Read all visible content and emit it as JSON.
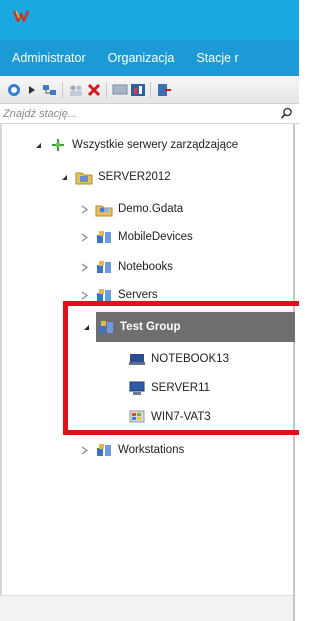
{
  "menu": {
    "items": [
      "Administrator",
      "Organizacja",
      "Stacje r"
    ]
  },
  "toolbar": {
    "icons": [
      "back-icon",
      "play-icon",
      "network-add-icon",
      "users-icon",
      "delete-x-icon",
      "monitor-icon",
      "report-icon",
      "export-icon"
    ]
  },
  "search": {
    "placeholder": "Znajdź stację..."
  },
  "tree": {
    "root": "Wszystkie serwery zarządzające",
    "server": "SERVER2012",
    "groups": {
      "demo": "Demo.Gdata",
      "mobile": "MobileDevices",
      "notebooks": "Notebooks",
      "servers": "Servers",
      "test": "Test Group",
      "workstations": "Workstations"
    },
    "test_children": [
      "NOTEBOOK13",
      "SERVER11",
      "WIN7-VAT3"
    ]
  },
  "colors": {
    "titlebar": "#19a9e0",
    "menubar": "#1c9ad6",
    "selection": "#6e6e6e",
    "highlight": "#e0101d"
  }
}
